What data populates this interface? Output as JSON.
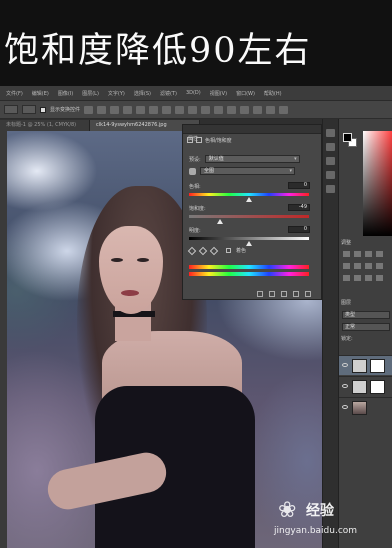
{
  "caption": {
    "text": "饱和度降低90左右"
  },
  "menubar": {
    "items": [
      "文件(F)",
      "编辑(E)",
      "图像(I)",
      "图层(L)",
      "文字(Y)",
      "选择(S)",
      "滤镜(T)",
      "3D(D)",
      "视图(V)",
      "窗口(W)",
      "帮助(H)"
    ]
  },
  "options_bar": {
    "show_transform_label": "显示变换控件"
  },
  "document_tabs": [
    {
      "label": "未标题-1 @ 25% (1, CMYK/8)"
    },
    {
      "label": "clk14-9yswyhm6242876.jpg"
    }
  ],
  "adjustments": {
    "tab_label": "属性",
    "title": "色相/饱和度",
    "preset_label": "预设:",
    "preset_value": "默认值",
    "channel_value": "全图",
    "hue_label": "色相:",
    "hue_value": "0",
    "hue_amount": 0,
    "saturation_label": "饱和度:",
    "saturation_value": "-49",
    "saturation_amount": -49,
    "lightness_label": "明度:",
    "lightness_value": "0",
    "lightness_amount": 0,
    "colorize_label": "着色"
  },
  "right_panel": {
    "adjust_tab": "调整",
    "layers_tab": "图层",
    "kind_label": "类型",
    "blend_mode": "正常",
    "lock_label": "锁定:"
  },
  "icons": [
    "move-tool-icon",
    "hue-saturation-icon",
    "hand-icon",
    "eyedropper-icon",
    "eye-icon",
    "visibility-icon"
  ],
  "colors": {
    "caption_bg": "#111111",
    "panel_bg": "#474747",
    "selected_layer": "#5f6c7c"
  },
  "watermark": {
    "brand": "经验",
    "url": "jingyan.baidu.com"
  }
}
